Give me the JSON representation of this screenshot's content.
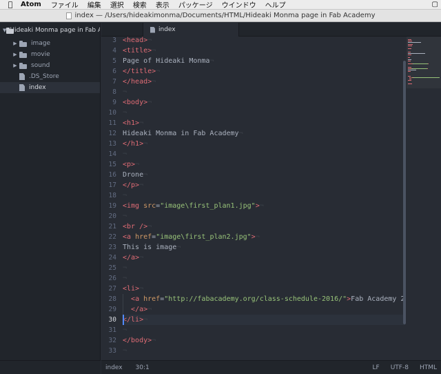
{
  "menubar": {
    "app": "Atom",
    "items": [
      "ファイル",
      "編集",
      "選択",
      "検索",
      "表示",
      "パッケージ",
      "ウインドウ",
      "ヘルプ"
    ]
  },
  "window": {
    "title": "index — /Users/hideakimonma/Documents/HTML/Hideaki Monma page in Fab Academy"
  },
  "tree": {
    "root": "Hideaki Monma page in Fab Academy",
    "items": [
      {
        "label": "image",
        "kind": "folder"
      },
      {
        "label": "movie",
        "kind": "folder"
      },
      {
        "label": "sound",
        "kind": "folder"
      },
      {
        "label": ".DS_Store",
        "kind": "file"
      },
      {
        "label": "index",
        "kind": "file",
        "selected": true
      }
    ]
  },
  "tab": {
    "label": "index"
  },
  "editor": {
    "first_line": 3,
    "active_line": 30,
    "lines": [
      [
        [
          "tag",
          "<head>"
        ]
      ],
      [
        [
          "tag",
          "<title>"
        ]
      ],
      [
        [
          "txt",
          "Page of Hideaki Monma"
        ]
      ],
      [
        [
          "tag",
          "</title>"
        ]
      ],
      [
        [
          "tag",
          "</head>"
        ]
      ],
      [],
      [
        [
          "tag",
          "<body>"
        ]
      ],
      [],
      [
        [
          "tag",
          "<h1>"
        ]
      ],
      [
        [
          "txt",
          "Hideaki Monma in Fab Academy"
        ]
      ],
      [
        [
          "tag",
          "</h1>"
        ]
      ],
      [],
      [
        [
          "tag",
          "<p>"
        ]
      ],
      [
        [
          "txt",
          "Drone"
        ]
      ],
      [
        [
          "tag",
          "</p>"
        ]
      ],
      [],
      [
        [
          "tag",
          "<img "
        ],
        [
          "attr",
          "src"
        ],
        [
          "punc",
          "="
        ],
        [
          "str",
          "\"image\\first_plan1.jpg\""
        ],
        [
          "tag",
          ">"
        ]
      ],
      [],
      [
        [
          "tag",
          "<br />"
        ]
      ],
      [
        [
          "tag",
          "<a "
        ],
        [
          "attr",
          "href"
        ],
        [
          "punc",
          "="
        ],
        [
          "str",
          "\"image\\first_plan2.jpg\""
        ],
        [
          "tag",
          ">"
        ]
      ],
      [
        [
          "txt",
          "This is image"
        ]
      ],
      [
        [
          "tag",
          "</a>"
        ]
      ],
      [],
      [],
      [
        [
          "tag",
          "<li>"
        ]
      ],
      [
        [
          "ind",
          "  "
        ],
        [
          "tag",
          "<a "
        ],
        [
          "attr",
          "href"
        ],
        [
          "punc",
          "="
        ],
        [
          "str",
          "\"http://fabacademy.org/class-schedule-2016/\""
        ],
        [
          "tag",
          ">"
        ],
        [
          "txt",
          "Fab Academy 2"
        ]
      ],
      [
        [
          "ind",
          "  "
        ],
        [
          "tag",
          "</a>"
        ]
      ],
      [
        [
          "tag",
          "</li>"
        ]
      ],
      [],
      [
        [
          "tag",
          "</body>"
        ]
      ],
      []
    ]
  },
  "statusbar": {
    "file": "index",
    "cursor": "30:1",
    "line_ending": "LF",
    "encoding": "UTF-8",
    "grammar": "HTML"
  },
  "colors": {
    "tag": "#e06c75",
    "attr": "#d19a66",
    "string": "#98c379",
    "text": "#abb2bf",
    "background": "#282c34"
  }
}
